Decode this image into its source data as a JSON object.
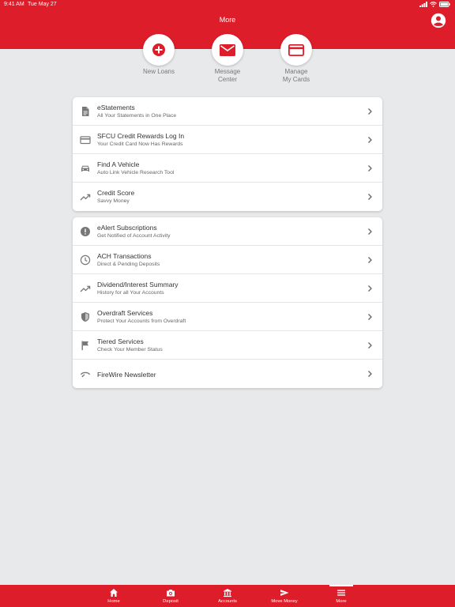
{
  "status": {
    "time": "9:41 AM",
    "date": "Tue May 27"
  },
  "header": {
    "title": "More"
  },
  "quick_actions": [
    {
      "label": "New Loans",
      "icon": "add-circle-icon"
    },
    {
      "label": "Message\nCenter",
      "icon": "mail-icon"
    },
    {
      "label": "Manage\nMy Cards",
      "icon": "credit-card-icon"
    }
  ],
  "section1": [
    {
      "title": "eStatements",
      "subtitle": "All Your Statements in One Place",
      "icon": "document-icon"
    },
    {
      "title": "SFCU Credit Rewards Log In",
      "subtitle": "Your Credit Card Now Has Rewards",
      "icon": "credit-card-icon"
    },
    {
      "title": "Find A Vehicle",
      "subtitle": "Auto Link Vehicle Research Tool",
      "icon": "car-icon"
    },
    {
      "title": "Credit Score",
      "subtitle": "Savvy Money",
      "icon": "trending-up-icon"
    }
  ],
  "section2": [
    {
      "title": "eAlert Subscriptions",
      "subtitle": "Get Notified of Account Activity",
      "icon": "alert-icon"
    },
    {
      "title": "ACH Transactions",
      "subtitle": "Direct & Pending Deposits",
      "icon": "clock-icon"
    },
    {
      "title": "Dividend/Interest Summary",
      "subtitle": "History for all Your Accounts",
      "icon": "trending-up-icon"
    },
    {
      "title": "Overdraft Services",
      "subtitle": "Protect Your Accounts from Overdraft",
      "icon": "shield-icon"
    },
    {
      "title": "Tiered Services",
      "subtitle": "Check Your Member Status",
      "icon": "flag-icon"
    },
    {
      "title": "FireWire Newsletter",
      "icon": "newsletter-icon"
    }
  ],
  "tabs": [
    {
      "label": "Home",
      "icon": "home-icon"
    },
    {
      "label": "Deposit",
      "icon": "camera-icon"
    },
    {
      "label": "Accounts",
      "icon": "bank-icon"
    },
    {
      "label": "Move Money",
      "icon": "send-icon"
    },
    {
      "label": "More",
      "icon": "menu-icon",
      "active": true
    }
  ],
  "colors": {
    "brand": "#dd1d2a",
    "background": "#e8e9eb",
    "icon_gray": "#777777"
  }
}
